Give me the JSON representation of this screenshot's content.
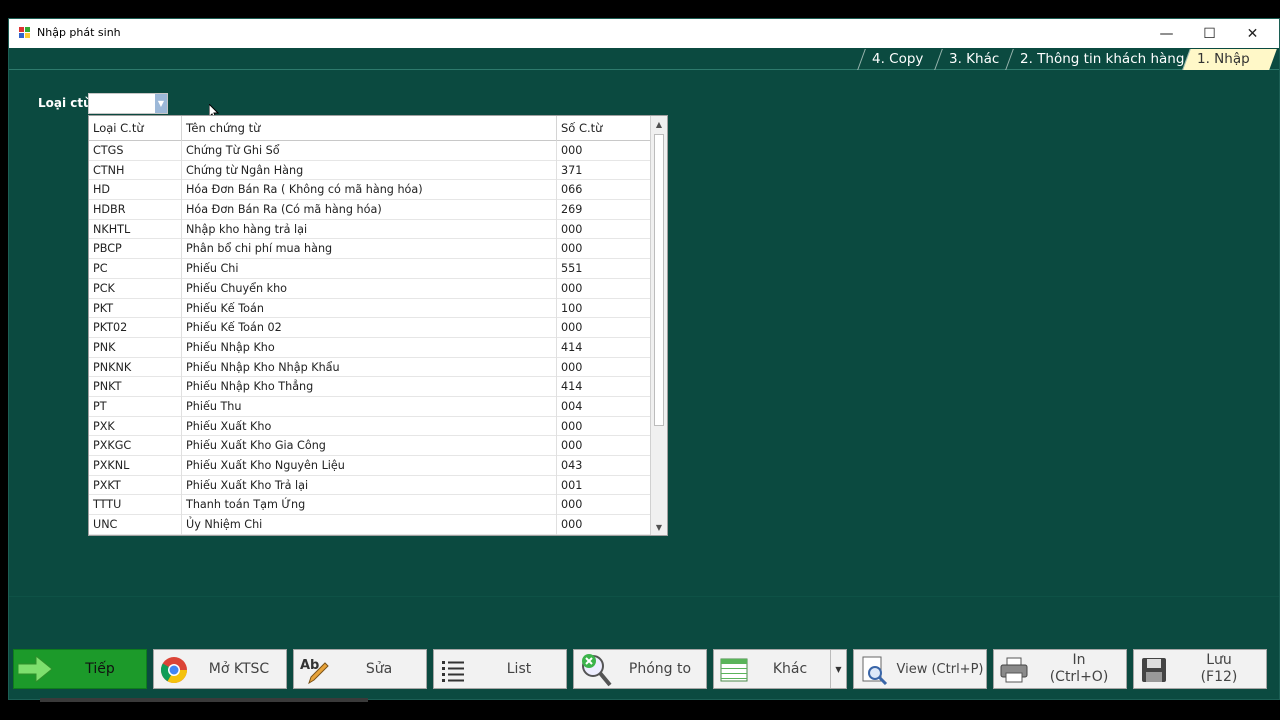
{
  "window": {
    "title": "Nhập phát sinh",
    "minimize": "—",
    "maximize": "☐",
    "close": "✕"
  },
  "tabs": [
    {
      "label": "4. Copy"
    },
    {
      "label": "3. Khác"
    },
    {
      "label": "2. Thông tin khách hàng"
    },
    {
      "label": "1. Nhập"
    }
  ],
  "filter": {
    "label": "Loại ctừ",
    "value": ""
  },
  "grid": {
    "headers": [
      "Loại C.từ",
      "Tên chứng từ",
      "Số C.từ"
    ],
    "rows": [
      {
        "code": "CTGS",
        "name": "Chứng Từ Ghi Sổ",
        "num": "000"
      },
      {
        "code": "CTNH",
        "name": "Chứng từ  Ngân Hàng",
        "num": "371"
      },
      {
        "code": "HD",
        "name": "Hóa Đơn Bán Ra ( Không có mã hàng hóa)",
        "num": "066"
      },
      {
        "code": "HDBR",
        "name": "Hóa Đơn Bán Ra (Có mã hàng hóa)",
        "num": "269"
      },
      {
        "code": "NKHTL",
        "name": "Nhập kho hàng trả lại",
        "num": "000"
      },
      {
        "code": "PBCP",
        "name": "Phân bổ chi phí mua hàng",
        "num": "000"
      },
      {
        "code": "PC",
        "name": "Phiếu Chi",
        "num": "551"
      },
      {
        "code": "PCK",
        "name": "Phiếu Chuyển kho",
        "num": "000"
      },
      {
        "code": "PKT",
        "name": "Phiếu Kế Toán",
        "num": "100"
      },
      {
        "code": "PKT02",
        "name": "Phiếu Kế Toán 02",
        "num": "000"
      },
      {
        "code": "PNK",
        "name": "Phiếu Nhập Kho",
        "num": "414"
      },
      {
        "code": "PNKNK",
        "name": "Phiếu Nhập Kho Nhập Khẩu",
        "num": "000"
      },
      {
        "code": "PNKT",
        "name": "Phiếu Nhập Kho Thẳng",
        "num": "414"
      },
      {
        "code": "PT",
        "name": "Phiếu Thu",
        "num": "004"
      },
      {
        "code": "PXK",
        "name": "Phiếu Xuất Kho",
        "num": "000"
      },
      {
        "code": "PXKGC",
        "name": "Phiếu Xuất Kho Gia Công",
        "num": "000"
      },
      {
        "code": "PXKNL",
        "name": "Phiếu Xuất Kho Nguyên Liệu",
        "num": "043"
      },
      {
        "code": "PXKT",
        "name": "Phiếu Xuất Kho Trả lại",
        "num": "001"
      },
      {
        "code": "TTTU",
        "name": "Thanh toán Tạm Ứng",
        "num": "000"
      },
      {
        "code": "UNC",
        "name": "Ủy Nhiệm Chi",
        "num": "000"
      }
    ]
  },
  "buttons": [
    {
      "label": "Tiếp"
    },
    {
      "label": "Mở KTSC"
    },
    {
      "label": "Sửa"
    },
    {
      "label": "List"
    },
    {
      "label": "Phóng to"
    },
    {
      "label": "Khác"
    },
    {
      "label": "View (Ctrl+P)"
    },
    {
      "label": "In\n(Ctrl+O)"
    },
    {
      "label": "Lưu\n(F12)"
    }
  ],
  "colors": {
    "background": "#0b4a40",
    "active_tab": "#fff8c8",
    "green_button": "#1c9a2a"
  }
}
